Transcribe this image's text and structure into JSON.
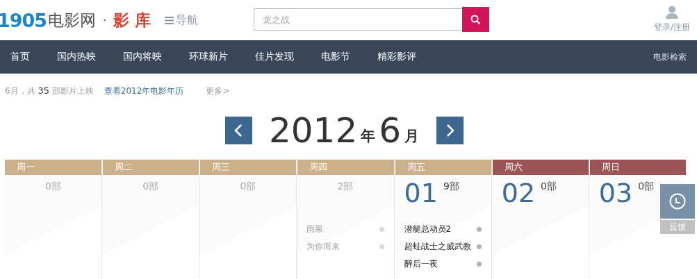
{
  "header": {
    "logo_number": "1905",
    "logo_text": "电影网",
    "separator": "·",
    "section_title": "影 库",
    "nav_toggle": "导航",
    "search": {
      "placeholder": "龙之战"
    },
    "login": "登录/注册"
  },
  "nav": {
    "items": [
      {
        "label": "首页",
        "selected": false
      },
      {
        "label": "国内热映",
        "selected": false
      },
      {
        "label": "国内将映",
        "selected": false
      },
      {
        "label": "环球新片",
        "selected": false
      },
      {
        "label": "佳片发现",
        "selected": false
      },
      {
        "label": "电影节",
        "selected": false
      },
      {
        "label": "精彩影评",
        "selected": false
      }
    ],
    "right_link": "电影检索"
  },
  "info": {
    "month": "6月，共",
    "count": "35",
    "suffix": "部影片上映",
    "calendar_link": "查看2012年电影年历",
    "more": "更多>"
  },
  "month_title": {
    "year": "2012",
    "year_unit": "年",
    "month": "6",
    "month_unit": "月"
  },
  "calendar": {
    "days": [
      {
        "weekday": "周一",
        "weekend": false,
        "faded": true,
        "count": "0",
        "unit": "部"
      },
      {
        "weekday": "周二",
        "weekend": false,
        "faded": true,
        "count": "0",
        "unit": "部"
      },
      {
        "weekday": "周三",
        "weekend": false,
        "faded": true,
        "count": "0",
        "unit": "部"
      },
      {
        "weekday": "周四",
        "weekend": false,
        "faded": true,
        "count": "2",
        "unit": "部",
        "movies": [
          "雨果",
          "为你而来"
        ]
      },
      {
        "weekday": "周五",
        "weekend": false,
        "faded": false,
        "date": "01",
        "count": "9",
        "unit": "部",
        "movies": [
          "潜艇总动员2",
          "超蛙战士之威武教",
          "醉后一夜"
        ]
      },
      {
        "weekday": "周六",
        "weekend": true,
        "faded": false,
        "date": "02",
        "count": "0",
        "unit": "部"
      },
      {
        "weekday": "周日",
        "weekend": true,
        "faded": false,
        "date": "03",
        "count": "0",
        "unit": "部"
      }
    ]
  },
  "feedback": {
    "label": "反馈"
  }
}
